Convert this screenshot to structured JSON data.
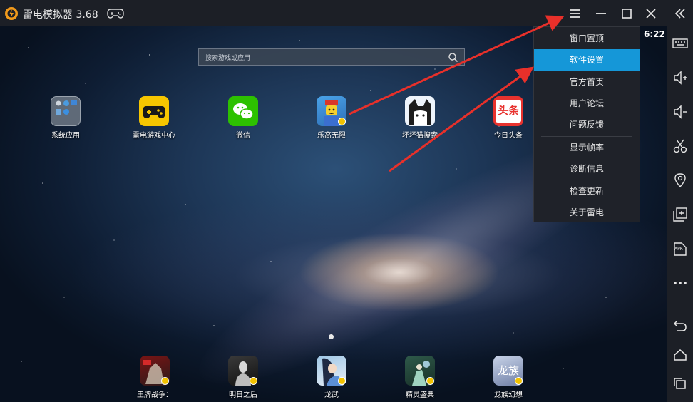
{
  "window": {
    "title": "雷电模拟器 3.68",
    "logo_icon": "thunder-logo-icon",
    "gamepad_icon": "gamepad-icon",
    "controls": [
      "menu-icon",
      "minimize-icon",
      "maximize-icon",
      "close-icon"
    ]
  },
  "status": {
    "time": "6:22"
  },
  "search": {
    "placeholder": "搜索游戏或应用",
    "icon": "search-icon"
  },
  "desktop": {
    "top_apps": [
      {
        "label": "系统应用",
        "icon": "system-apps-folder-icon"
      },
      {
        "label": "雷电游戏中心",
        "icon": "game-center-icon"
      },
      {
        "label": "微信",
        "icon": "wechat-icon"
      },
      {
        "label": "乐高无限",
        "icon": "lego-icon"
      },
      {
        "label": "坏坏猫搜索",
        "icon": "cat-search-icon"
      },
      {
        "label": "今日头条",
        "icon": "toutiao-icon",
        "icon_text": "头条"
      }
    ],
    "dock_apps": [
      {
        "label": "王牌战争：",
        "icon": "war-game-icon"
      },
      {
        "label": "明日之后",
        "icon": "lifeafter-icon"
      },
      {
        "label": "龙武",
        "icon": "longwu-icon"
      },
      {
        "label": "精灵盛典",
        "icon": "elf-icon"
      },
      {
        "label": "龙族幻想",
        "icon": "dragon-fantasy-icon",
        "icon_text": "龙族"
      }
    ]
  },
  "dropdown_menu": {
    "items": [
      "窗口置顶",
      "软件设置",
      "官方首页",
      "用户论坛",
      "问题反馈",
      "显示帧率",
      "诊断信息",
      "检查更新",
      "关于雷电"
    ],
    "active": "软件设置"
  },
  "sidebar": {
    "buttons": [
      "collapse-icon",
      "keyboard-icon",
      "volume-up-icon",
      "volume-down-icon",
      "screenshot-icon",
      "location-icon",
      "multi-instance-icon",
      "apk-icon",
      "more-icon",
      "back-icon",
      "home-icon",
      "recent-apps-icon"
    ],
    "apk_text": "APK"
  },
  "colors": {
    "accent": "#1597d8",
    "titlebar": "#1c1f26",
    "arrow": "#e8302a"
  }
}
